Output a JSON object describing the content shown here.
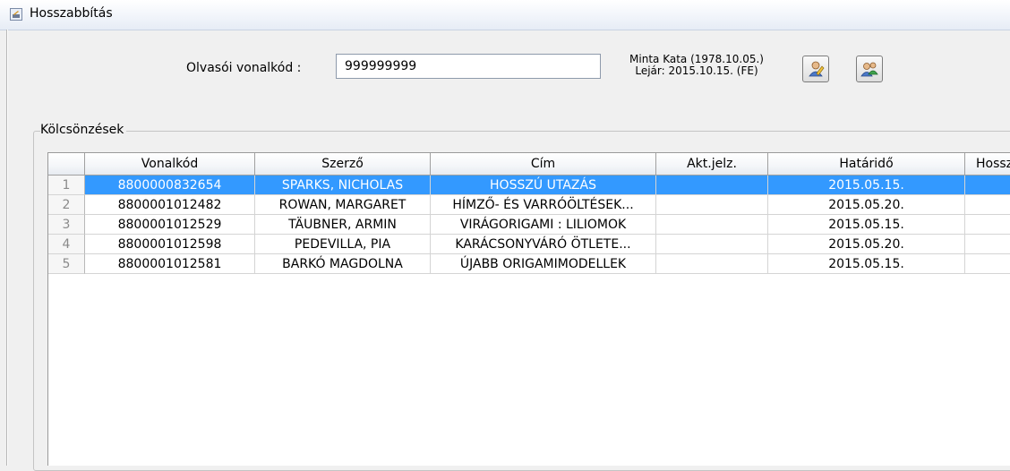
{
  "window": {
    "title": "Hosszabbítás"
  },
  "reader": {
    "barcode_label": "Olvasói vonalkód :",
    "barcode_value": "999999999",
    "name_line": "Minta Kata (1978.10.05.)",
    "expiry_line": "Lejár: 2015.10.15. (FE)"
  },
  "loans": {
    "group_title": "Kölcsönzések",
    "columns": [
      "",
      "Vonalkód",
      "Szerző",
      "Cím",
      "Akt.jelz.",
      "Határidő",
      "Hossz"
    ],
    "rows": [
      {
        "n": "1",
        "barcode": "8800000832654",
        "author": "SPARKS, NICHOLAS",
        "title": "HOSSZÚ UTAZÁS",
        "call_no": "",
        "due": "2015.05.15.",
        "extra": ""
      },
      {
        "n": "2",
        "barcode": "8800001012482",
        "author": "ROWAN, MARGARET",
        "title": "HÍMZŐ- ÉS VARRÓÖLTÉSEK...",
        "call_no": "",
        "due": "2015.05.20.",
        "extra": ""
      },
      {
        "n": "3",
        "barcode": "8800001012529",
        "author": "TÄUBNER, ARMIN",
        "title": "VIRÁGORIGAMI : LILIOMOK",
        "call_no": "",
        "due": "2015.05.15.",
        "extra": ""
      },
      {
        "n": "4",
        "barcode": "8800001012598",
        "author": "PEDEVILLA, PIA",
        "title": "KARÁCSONYVÁRÓ ÖTLETE...",
        "call_no": "",
        "due": "2015.05.20.",
        "extra": ""
      },
      {
        "n": "5",
        "barcode": "8800001012581",
        "author": "BARKÓ MAGDOLNA",
        "title": "ÚJABB ORIGAMIMODELLEK",
        "call_no": "",
        "due": "2015.05.15.",
        "extra": ""
      }
    ],
    "selected_row": 0
  },
  "icons": {
    "window": "app-window-icon",
    "button1": "edit-reader-icon",
    "button2": "reader-details-icon"
  },
  "colors": {
    "selection": "#3399ff",
    "background": "#f0f0f0"
  }
}
